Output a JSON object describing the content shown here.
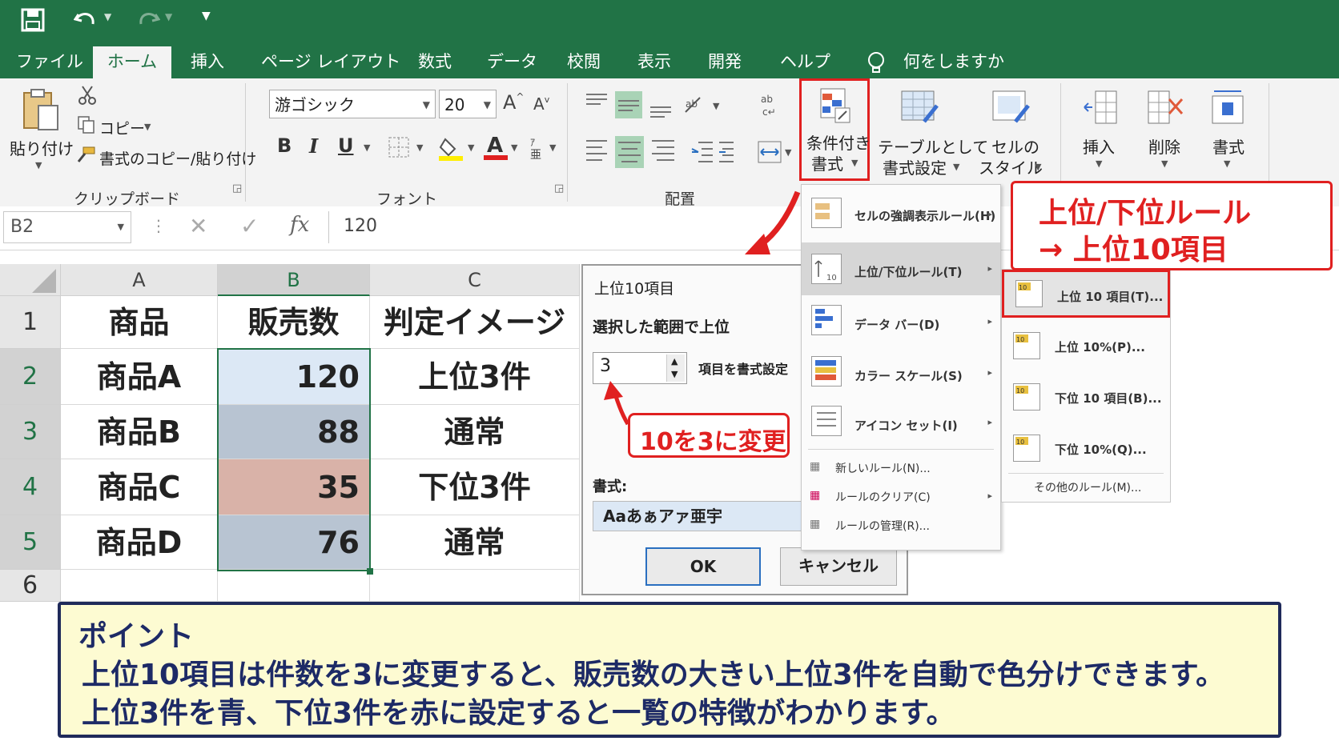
{
  "ribbon_tabs": [
    "ファイル",
    "ホーム",
    "挿入",
    "ページ レイアウト",
    "数式",
    "データ",
    "校閲",
    "表示",
    "開発",
    "ヘルプ"
  ],
  "active_tab": "ホーム",
  "tell_me": "何をしますか",
  "clipboard": {
    "paste": "貼り付け",
    "copy": "コピー",
    "format_painter": "書式のコピー/貼り付け",
    "group": "クリップボード"
  },
  "font": {
    "name": "游ゴシック",
    "size": "20",
    "bold": "B",
    "italic": "I",
    "underline": "U",
    "group": "フォント"
  },
  "alignment": {
    "group": "配置"
  },
  "styles": {
    "conditional_line1": "条件付き",
    "conditional_line2": "書式",
    "table_line1": "テーブルとして",
    "table_line2": "書式設定",
    "cell_line1": "セルの",
    "cell_line2": "スタイル"
  },
  "cells": {
    "insert": "挿入",
    "delete": "削除",
    "format": "書式"
  },
  "formula_bar": {
    "name_box": "B2",
    "fx": "fx",
    "value": "120"
  },
  "columns": [
    "A",
    "B",
    "C"
  ],
  "rows": [
    "1",
    "2",
    "3",
    "4",
    "5",
    "6"
  ],
  "sheet": {
    "header": [
      "商品",
      "販売数",
      "判定イメージ"
    ],
    "data": [
      [
        "商品A",
        "120",
        "上位3件"
      ],
      [
        "商品B",
        "88",
        "通常"
      ],
      [
        "商品C",
        "35",
        "下位3件"
      ],
      [
        "商品D",
        "76",
        "通常"
      ]
    ],
    "colors": {
      "top": "#dce8f5",
      "normal": "#b8c4d2",
      "bottom": "#d9b2a8"
    }
  },
  "dialog": {
    "title": "上位10項目",
    "label": "選択した範囲で上位",
    "count": "3",
    "suffix": "項目を書式設定",
    "format_label": "書式:",
    "preview": "Aaあぁアァ亜宇",
    "ok": "OK",
    "cancel": "キャンセル"
  },
  "menu": {
    "items": [
      "セルの強調表示ルール(H)",
      "上位/下位ルール(T)",
      "データ バー(D)",
      "カラー スケール(S)",
      "アイコン セット(I)"
    ],
    "small_items": [
      "新しいルール(N)...",
      "ルールのクリア(C)",
      "ルールの管理(R)..."
    ]
  },
  "submenu": {
    "items": [
      "上位 10 項目(T)...",
      "上位 10%(P)...",
      "下位 10 項目(B)...",
      "下位 10%(Q)..."
    ],
    "more": "その他のルール(M)...",
    "icon_label": "10"
  },
  "callouts": {
    "rule_line1": "上位/下位ルール",
    "rule_line2": "→ 上位10項目",
    "change": "10を3に変更"
  },
  "note": {
    "title": "ポイント",
    "line1": "上位10項目は件数を3に変更すると、販売数の大きい上位3件を自動で色分けできます。",
    "line2": "上位3件を青、下位3件を赤に設定すると一覧の特徴がわかります。"
  },
  "accent_color": "#217346",
  "highlight_color": "#e02020"
}
